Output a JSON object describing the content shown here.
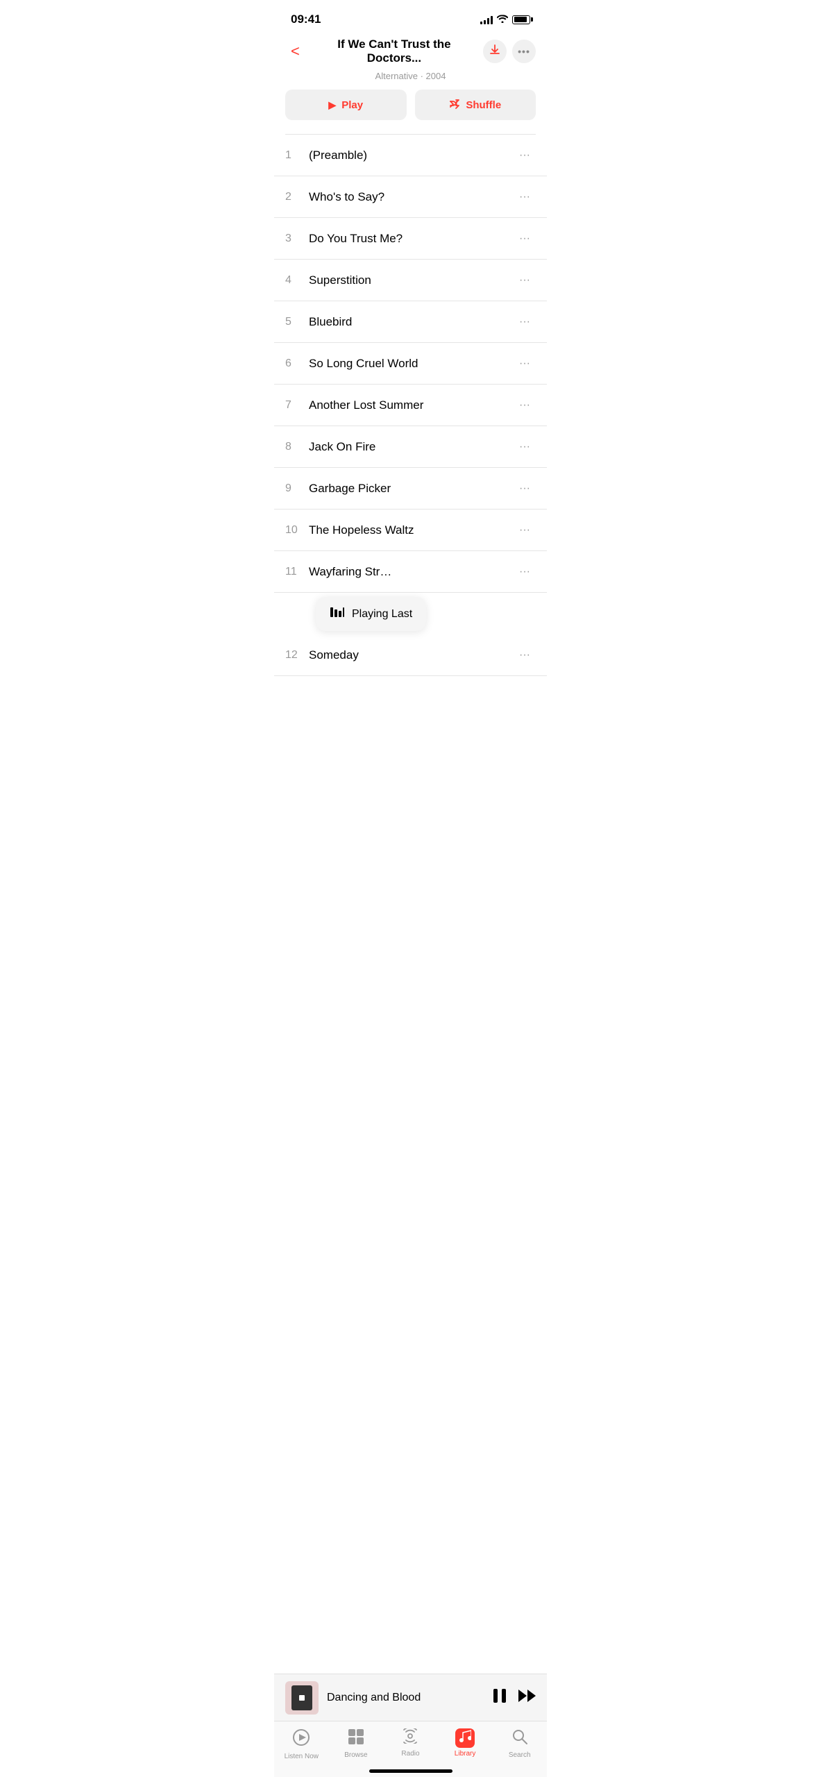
{
  "statusBar": {
    "time": "09:41",
    "signalBars": [
      4,
      6,
      8,
      10,
      12
    ],
    "battery": 90
  },
  "header": {
    "backLabel": "<",
    "title": "If We Can't Trust the Doctors...",
    "subtitle": "Alternative · 2004"
  },
  "actions": {
    "playLabel": "Play",
    "shuffleLabel": "Shuffle"
  },
  "tracks": [
    {
      "number": "1",
      "title": "(Preamble)"
    },
    {
      "number": "2",
      "title": "Who's to Say?"
    },
    {
      "number": "3",
      "title": "Do You Trust Me?"
    },
    {
      "number": "4",
      "title": "Superstition"
    },
    {
      "number": "5",
      "title": "Bluebird"
    },
    {
      "number": "6",
      "title": "So Long Cruel World"
    },
    {
      "number": "7",
      "title": "Another Lost Summer"
    },
    {
      "number": "8",
      "title": "Jack On Fire"
    },
    {
      "number": "9",
      "title": "Garbage Picker"
    },
    {
      "number": "10",
      "title": "The Hopeless Waltz"
    },
    {
      "number": "11",
      "title": "Wayfaring Str…"
    },
    {
      "number": "12",
      "title": "Someday"
    }
  ],
  "tooltip": {
    "label": "Playing Last"
  },
  "nowPlaying": {
    "title": "Dancing and Blood"
  },
  "tabBar": {
    "tabs": [
      {
        "id": "listen-now",
        "label": "Listen Now",
        "icon": "▶"
      },
      {
        "id": "browse",
        "label": "Browse",
        "icon": "⊞"
      },
      {
        "id": "radio",
        "label": "Radio",
        "icon": "◉"
      },
      {
        "id": "library",
        "label": "Library",
        "icon": "♪",
        "active": true
      },
      {
        "id": "search",
        "label": "Search",
        "icon": "⌕"
      }
    ]
  }
}
